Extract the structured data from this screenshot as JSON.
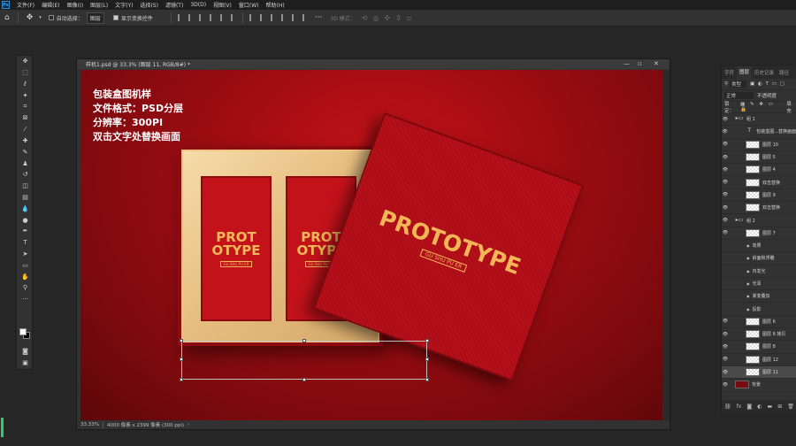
{
  "menu": [
    "文件(F)",
    "编辑(E)",
    "图像(I)",
    "图层(L)",
    "文字(Y)",
    "选择(S)",
    "滤镜(T)",
    "3D(D)",
    "视图(V)",
    "窗口(W)",
    "帮助(H)"
  ],
  "options": {
    "auto_select_label": "自动选择：",
    "auto_select_value": "图层",
    "show_transform_label": "显示变换控件",
    "mode_3d_label": "3D 模式："
  },
  "document": {
    "tab_title": "样机1.psd @ 33.3% (图层 11, RGB/8#) *",
    "zoom": "33.33%",
    "doc_size": "4000 像素 x 2399 像素 (300 ppi)"
  },
  "canvas": {
    "overlay_lines": [
      "包装盒图机样",
      "文件格式：PSD分层",
      "分辨率：300PI",
      "双击文字处替换画面"
    ],
    "card_title_line1": "PROT",
    "card_title_line2": "OTYPE",
    "card_sub": "GU SHU PU ER",
    "lid_title": "PROTOTYPE",
    "lid_sub": "GU SHU PU ER"
  },
  "panel": {
    "tabs": [
      "字符",
      "图层",
      "历史记录",
      "路径"
    ],
    "active_tab": "图层",
    "filter_kind": "类型",
    "blend_mode": "正常",
    "opacity_label": "不透明度",
    "lock_label": "锁定：",
    "fill_label": "填充",
    "layers": [
      {
        "name": "组 1",
        "kind": "folder",
        "indent": 1
      },
      {
        "name": "包装盒图...替换画面",
        "kind": "text",
        "indent": 2
      },
      {
        "name": "图层 10",
        "kind": "layer",
        "indent": 2
      },
      {
        "name": "图层 5",
        "kind": "layer",
        "indent": 2
      },
      {
        "name": "图层 4",
        "kind": "layer",
        "indent": 2
      },
      {
        "name": "双击替换",
        "kind": "layer",
        "indent": 2
      },
      {
        "name": "图层 9",
        "kind": "layer",
        "indent": 2
      },
      {
        "name": "双击替换",
        "kind": "layer",
        "indent": 2
      },
      {
        "name": "组 2",
        "kind": "folder",
        "indent": 1
      },
      {
        "name": "图层 7",
        "kind": "layer",
        "indent": 2
      },
      {
        "name": "效果",
        "kind": "fx",
        "indent": 2
      },
      {
        "name": "斜面和浮雕",
        "kind": "fx",
        "indent": 2
      },
      {
        "name": "内发光",
        "kind": "fx",
        "indent": 2
      },
      {
        "name": "光泽",
        "kind": "fx",
        "indent": 2
      },
      {
        "name": "渐变叠加",
        "kind": "fx",
        "indent": 2
      },
      {
        "name": "投影",
        "kind": "fx",
        "indent": 2
      },
      {
        "name": "图层 6",
        "kind": "layer",
        "indent": 2
      },
      {
        "name": "图层 8 拷贝",
        "kind": "layer",
        "indent": 2
      },
      {
        "name": "图层 8",
        "kind": "layer",
        "indent": 2
      },
      {
        "name": "图层 12",
        "kind": "layer",
        "indent": 2
      },
      {
        "name": "图层 11",
        "kind": "layer",
        "indent": 2,
        "selected": true
      },
      {
        "name": "背景",
        "kind": "bg",
        "indent": 1
      }
    ],
    "bottom_icons": [
      "link-icon",
      "fx-icon",
      "mask-icon",
      "adjustment-icon",
      "folder-icon",
      "new-layer-icon",
      "trash-icon"
    ]
  }
}
